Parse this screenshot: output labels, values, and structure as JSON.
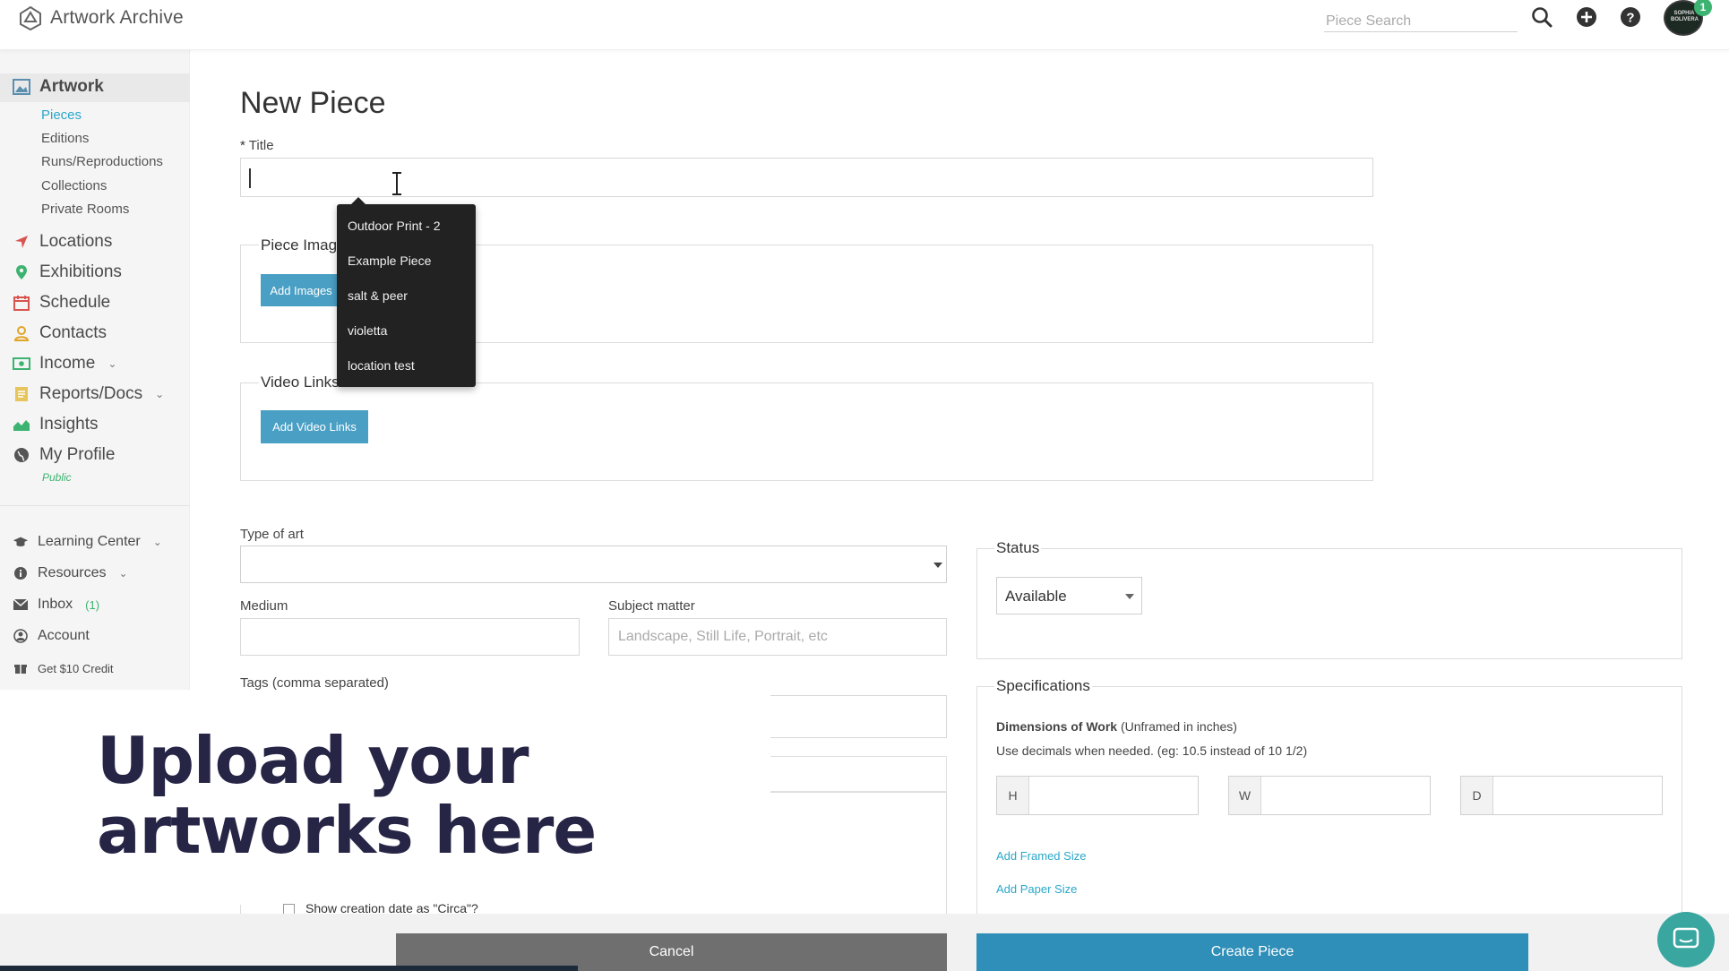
{
  "app": {
    "name": "Artwork Archive"
  },
  "header": {
    "search_placeholder": "Piece Search",
    "avatar_text": "SOPHIA BOLIVERA",
    "notification_count": "1"
  },
  "sidebar": {
    "artwork": {
      "label": "Artwork",
      "sub": [
        "Pieces",
        "Editions",
        "Runs/Reproductions",
        "Collections",
        "Private Rooms"
      ]
    },
    "items": [
      "Locations",
      "Exhibitions",
      "Schedule",
      "Contacts",
      "Income",
      "Reports/Docs",
      "Insights",
      "My Profile"
    ],
    "public_label": "Public",
    "secondary": {
      "learning": "Learning Center",
      "resources": "Resources",
      "inbox": "Inbox",
      "inbox_count": "(1)",
      "account": "Account",
      "credit": "Get $10 Credit"
    }
  },
  "form": {
    "page_title": "New Piece",
    "title_required_mark": "*",
    "title_label": "Title",
    "title_value": "",
    "autocomplete": [
      "Outdoor Print - 2",
      "Example Piece",
      "salt & peer",
      "violetta",
      "location test"
    ],
    "piece_images_label": "Piece Image",
    "add_images_label": "Add Images",
    "video_links_label": "Video Links",
    "add_video_links_label": "Add Video Links",
    "type_of_art_label": "Type of art",
    "type_of_art_value": "",
    "medium_label": "Medium",
    "subject_matter_label": "Subject matter",
    "subject_matter_placeholder": "Landscape, Still Life, Portrait, etc",
    "tags_label": "Tags (comma separated)",
    "circa_label": "Show creation date as \"Circa\"?",
    "status": {
      "legend": "Status",
      "value": "Available"
    },
    "specifications": {
      "legend": "Specifications",
      "dimensions_title": "Dimensions of Work",
      "dimensions_note": "(Unframed in inches)",
      "decimals_hint": "Use decimals when needed. (eg: 10.5 instead of 10 1/2)",
      "h": "H",
      "w": "W",
      "d": "D",
      "add_framed": "Add Framed Size",
      "add_paper": "Add Paper Size"
    }
  },
  "promo": {
    "line1": "Upload your",
    "line2": "artworks here"
  },
  "footer": {
    "cancel": "Cancel",
    "create": "Create Piece"
  },
  "colors": {
    "accent_blue": "#4a9fc4",
    "create_blue": "#2f8fb8",
    "teal_link": "#2aa7c9",
    "green": "#3cb371",
    "promo_text": "#262546"
  }
}
